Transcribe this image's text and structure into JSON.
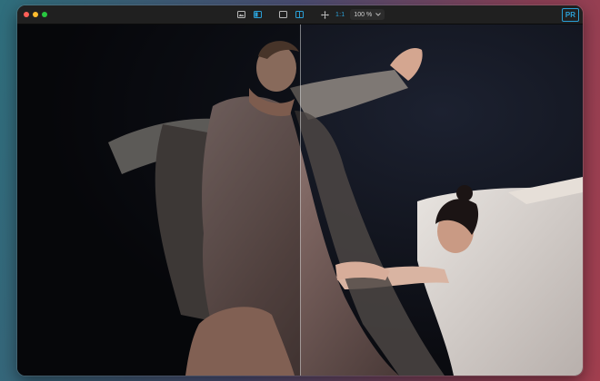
{
  "toolbar": {
    "buttons": [
      {
        "icon": "image-icon"
      },
      {
        "icon": "split-view-icon",
        "active": true
      },
      {
        "icon": "single-view-icon"
      },
      {
        "icon": "compare-icon",
        "active": true
      },
      {
        "icon": "move-icon"
      }
    ],
    "actual_size_label": "1:1",
    "zoom_value": "100 %"
  },
  "app_badge": "PR",
  "colors": {
    "accent": "#2a9fd6",
    "close": "#ff5f57",
    "minimize": "#febc2e",
    "zoom": "#28c840"
  },
  "comparison": {
    "divider_position": 0.5
  }
}
